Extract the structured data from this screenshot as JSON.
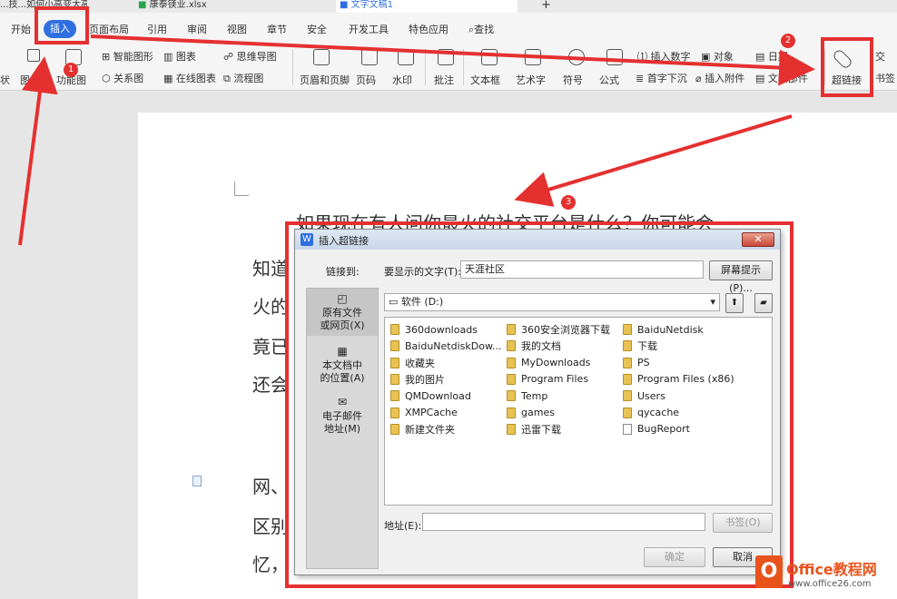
{
  "doc_tabs": {
    "tab1": "...技...如何小高变大高",
    "tab2": "康泰镁业.xlsx",
    "tab3": "文字文稿1"
  },
  "menu": {
    "items": [
      "开始",
      "插入",
      "页面布局",
      "引用",
      "审阅",
      "视图",
      "章节",
      "安全",
      "开发工具",
      "特色应用",
      "查找"
    ]
  },
  "toolbar": {
    "smartshape": "智能图形",
    "chart": "图表",
    "mindmap": "思维导图",
    "iconlib": "图标",
    "funcgraph": "功能图",
    "relation": "关系图",
    "onlinechart": "在线图表",
    "flowchart": "流程图",
    "headerfooter": "页眉和页脚",
    "pagenum": "页码",
    "watermark": "水印",
    "comment": "批注",
    "textbox": "文本框",
    "wordart": "艺术字",
    "symbol": "符号",
    "formula": "公式",
    "insertnum": "插入数字",
    "object": "对象",
    "date": "日期",
    "dropcap": "首字下沉",
    "attach": "插入附件",
    "docpart": "文档部件",
    "hyperlink": "超链接",
    "cross": "交",
    "bookmark": "书签",
    "left_cut": "状",
    "left_cut2": "本"
  },
  "page": {
    "lines": [
      "如果现在有人问你最火的社交平台是什么？你可能会",
      "知道",
      "火的",
      "竟已",
      "还会",
      "网、",
      "区别",
      "忆，"
    ]
  },
  "dialog": {
    "title": "插入超链接",
    "close": "✕",
    "link_to": "链接到:",
    "display_text_label": "要显示的文字(T):",
    "display_text_value": "天涯社区",
    "tooltip_btn": "屏幕提示(P)...",
    "folder_value": "软件 (D:)",
    "sidebar": {
      "existing": "原有文件或网页(X)",
      "place": "本文档中的位置(A)",
      "email": "电子邮件地址(M)"
    },
    "files": [
      {
        "name": "360downloads",
        "type": "folder"
      },
      {
        "name": "360安全浏览器下载",
        "type": "folder"
      },
      {
        "name": "BaiduNetdisk",
        "type": "folder"
      },
      {
        "name": "BaiduNetdiskDow...",
        "type": "folder"
      },
      {
        "name": "我的文档",
        "type": "folder"
      },
      {
        "name": "下载",
        "type": "folder"
      },
      {
        "name": "收藏夹",
        "type": "folder"
      },
      {
        "name": "MyDownloads",
        "type": "folder"
      },
      {
        "name": "PS",
        "type": "folder"
      },
      {
        "name": "我的图片",
        "type": "folder"
      },
      {
        "name": "Program Files",
        "type": "folder"
      },
      {
        "name": "Program Files (x86)",
        "type": "folder"
      },
      {
        "name": "QMDownload",
        "type": "folder"
      },
      {
        "name": "Temp",
        "type": "folder"
      },
      {
        "name": "Users",
        "type": "folder"
      },
      {
        "name": "XMPCache",
        "type": "folder"
      },
      {
        "name": "games",
        "type": "folder"
      },
      {
        "name": "qycache",
        "type": "folder"
      },
      {
        "name": "新建文件夹",
        "type": "folder"
      },
      {
        "name": "迅雷下载",
        "type": "folder"
      },
      {
        "name": "BugReport",
        "type": "file"
      }
    ],
    "address_label": "地址(E):",
    "address_value": "",
    "bookmark_btn": "书签(O)",
    "ok": "确定",
    "cancel": "取消"
  },
  "annotations": {
    "badge1": "1",
    "badge2": "2",
    "badge3": "3",
    "color": "#e53030"
  },
  "watermark": {
    "brand": "Office教程网",
    "url": "www.office26.com"
  }
}
